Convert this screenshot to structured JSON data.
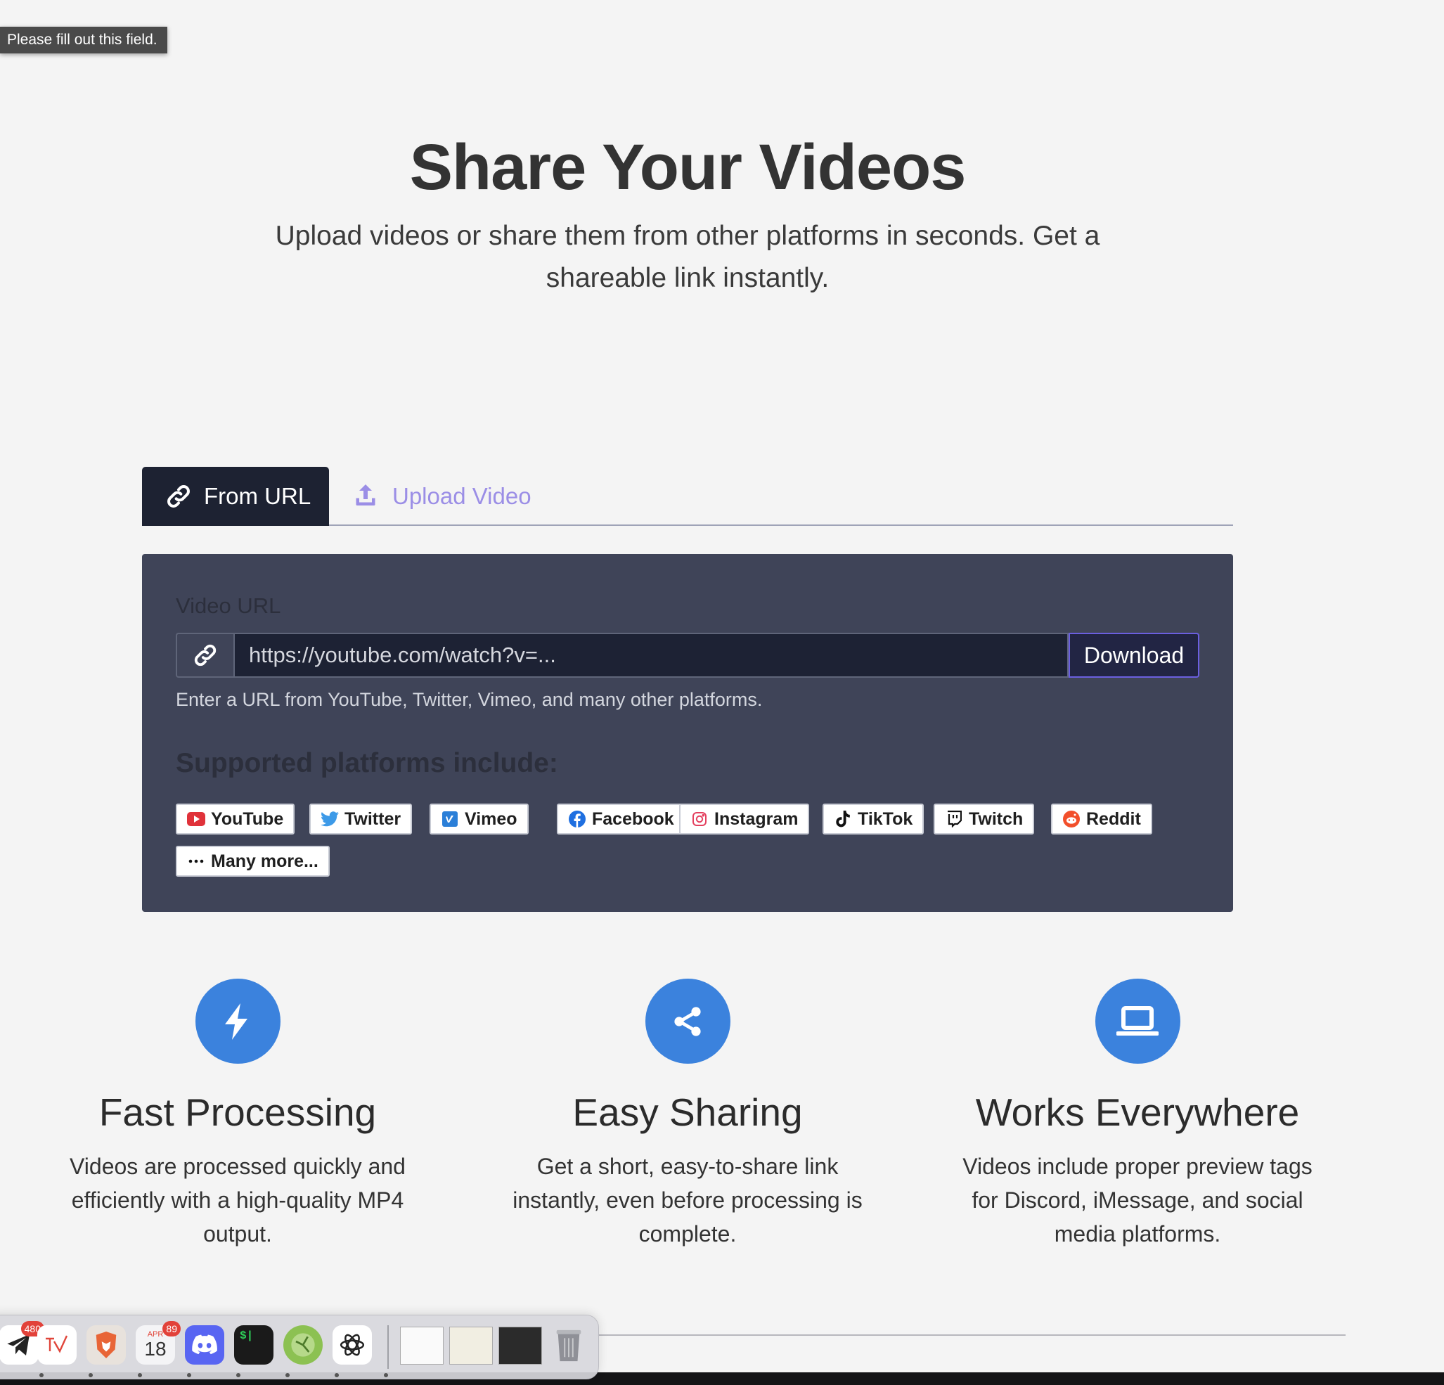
{
  "tooltip": "Please fill out this field.",
  "hero": {
    "title": "Share Your Videos",
    "subtitle": "Upload videos or share them from other platforms in seconds. Get a shareable link instantly."
  },
  "tabs": [
    {
      "label": "From URL",
      "icon": "link-icon",
      "active": true
    },
    {
      "label": "Upload Video",
      "icon": "upload-icon",
      "active": false
    }
  ],
  "form": {
    "label": "Video URL",
    "placeholder": "https://youtube.com/watch?v=...",
    "value": "",
    "button": "Download",
    "help": "Enter a URL from YouTube, Twitter, Vimeo, and many other platforms."
  },
  "platforms": {
    "title": "Supported platforms include:",
    "items": [
      {
        "label": "YouTube",
        "icon": "youtube-icon"
      },
      {
        "label": "Twitter",
        "icon": "twitter-icon"
      },
      {
        "label": "Vimeo",
        "icon": "vimeo-icon"
      },
      {
        "label": "Facebook",
        "icon": "facebook-icon"
      },
      {
        "label": "Instagram",
        "icon": "instagram-icon"
      },
      {
        "label": "TikTok",
        "icon": "tiktok-icon"
      },
      {
        "label": "Twitch",
        "icon": "twitch-icon"
      },
      {
        "label": "Reddit",
        "icon": "reddit-icon"
      },
      {
        "label": "Many more...",
        "icon": "ellipsis-icon"
      }
    ]
  },
  "features": [
    {
      "title": "Fast Processing",
      "desc": "Videos are processed quickly and efficiently with a high-quality MP4 output.",
      "icon": "bolt-icon"
    },
    {
      "title": "Easy Sharing",
      "desc": "Get a short, easy-to-share link instantly, even before processing is complete.",
      "icon": "share-icon"
    },
    {
      "title": "Works Everywhere",
      "desc": "Videos include proper preview tags for Discord, iMessage, and social media platforms.",
      "icon": "laptop-icon"
    }
  ],
  "dock": {
    "badges": {
      "telegram": "480",
      "calendar": "89"
    },
    "calendar_month": "APR",
    "calendar_day": "18",
    "terminal_prompt": "$|"
  },
  "colors": {
    "accent": "#3b82dd",
    "card": "#3f4458",
    "tab_active": "#1d2232",
    "upload_tab": "#9b8ee6"
  }
}
